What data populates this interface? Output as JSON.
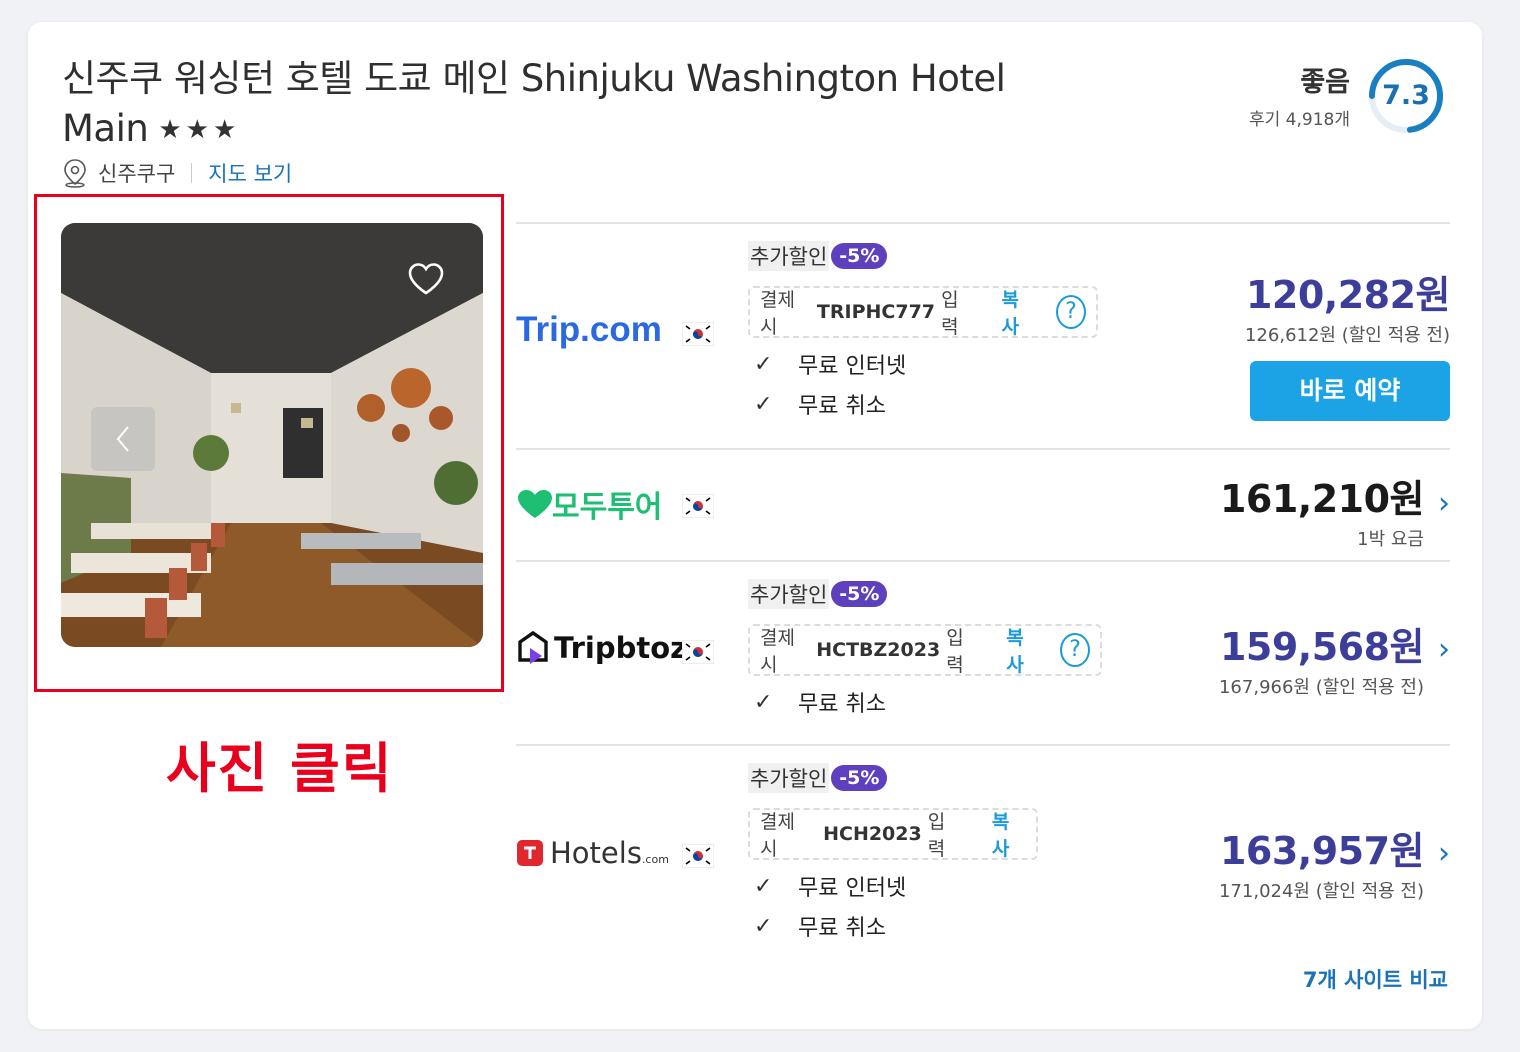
{
  "hotel": {
    "title": "신주쿠 워싱턴 호텔 도쿄 메인 Shinjuku Washington Hotel Main",
    "stars": "★★★",
    "area": "신주쿠구",
    "map_link": "지도 보기"
  },
  "rating": {
    "word": "좋음",
    "reviews": "후기 4,918개",
    "score": "7.3"
  },
  "annotation": {
    "caption": "사진 클릭",
    "color": "#e8001c"
  },
  "offers": [
    {
      "provider": "Trip.com",
      "badge_label": "추가할인",
      "badge_pct": "-5%",
      "coupon_prefix": "결제 시",
      "coupon_code": "TRIPHC777",
      "coupon_suffix": "입력",
      "copy_label": "복사",
      "features": [
        "무료 인터넷",
        "무료 취소"
      ],
      "price": "120,282원",
      "sub": "126,612원 (할인 적용 전)",
      "button": "바로 예약"
    },
    {
      "provider": "모두투어",
      "price": "161,210원",
      "sub": "1박 요금"
    },
    {
      "provider": "Tripbtoz",
      "badge_label": "추가할인",
      "badge_pct": "-5%",
      "coupon_prefix": "결제 시",
      "coupon_code": "HCTBZ2023",
      "coupon_suffix": "입력",
      "copy_label": "복사",
      "features": [
        "무료 취소"
      ],
      "price": "159,568원",
      "sub": "167,966원 (할인 적용 전)"
    },
    {
      "provider": "Hotels",
      "provider_suffix": ".com",
      "badge_label": "추가할인",
      "badge_pct": "-5%",
      "coupon_prefix": "결제 시",
      "coupon_code": "HCH2023",
      "coupon_suffix": "입력",
      "copy_label": "복사",
      "features": [
        "무료 인터넷",
        "무료 취소"
      ],
      "price": "163,957원",
      "sub": "171,024원 (할인 적용 전)"
    }
  ],
  "compare_link": "7개 사이트 비교",
  "colors": {
    "accent_blue": "#1ba3e6",
    "price_purple": "#3d3e9a",
    "badge_purple": "#5e3fbe",
    "link_blue": "#1a73b8"
  }
}
